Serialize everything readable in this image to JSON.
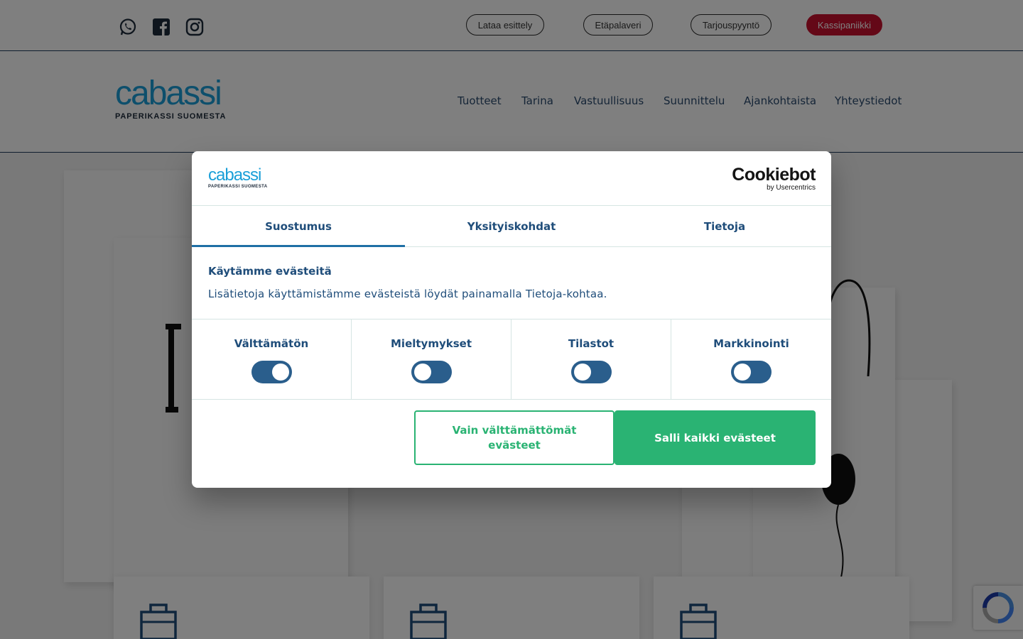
{
  "topbar": {
    "social": [
      "whatsapp-icon",
      "facebook-icon",
      "instagram-icon"
    ],
    "pills": [
      "Lataa esittely",
      "Etäpalaveri",
      "Tarjouspyyntö",
      "Kassipaniikki"
    ]
  },
  "header": {
    "logo_word": "cabassi",
    "logo_tagline": "PAPERIKASSI SUOMESTA",
    "nav": [
      "Tuotteet",
      "Tarina",
      "Vastuullisuus",
      "Suunnittelu",
      "Ajankohtaista",
      "Yhteystiedot"
    ]
  },
  "dialog": {
    "logo_word": "cabassi",
    "logo_tagline": "PAPERIKASSI SUOMESTA",
    "cookiebot": "Cookiebot",
    "cookiebot_by": "by Usercentrics",
    "tabs": [
      "Suostumus",
      "Yksityiskohdat",
      "Tietoja"
    ],
    "active_tab": "Suostumus",
    "title": "Käytämme evästeitä",
    "text": "Lisätietoja käyttämistämme evästeistä löydät painamalla Tietoja-kohtaa.",
    "toggles": [
      {
        "label": "Välttämätön",
        "on": true
      },
      {
        "label": "Mieltymykset",
        "on": false
      },
      {
        "label": "Tilastot",
        "on": false
      },
      {
        "label": "Markkinointi",
        "on": false
      }
    ],
    "btn_necessary": "Vain välttämättömät evästeet",
    "btn_all": "Salli kaikki evästeet"
  },
  "colors": {
    "brand_blue": "#1a9fd8",
    "dialog_text": "#1f4d7a",
    "accept_green": "#2ab373",
    "pill_red": "#c8102e"
  }
}
